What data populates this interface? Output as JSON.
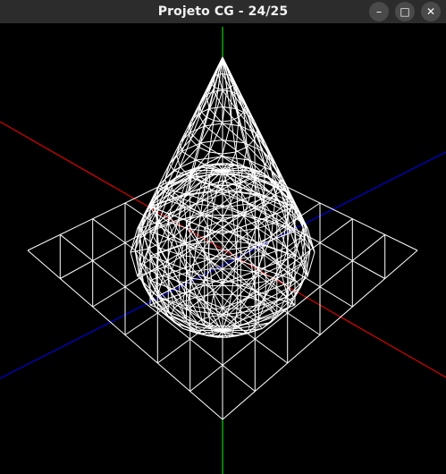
{
  "window": {
    "title": "Projeto CG - 24/25",
    "controls": {
      "minimize": {
        "icon": "minimize-icon",
        "glyph": "–"
      },
      "maximize": {
        "icon": "maximize-icon",
        "glyph": "□"
      },
      "close": {
        "icon": "close-icon",
        "glyph": "✕"
      }
    }
  },
  "scene": {
    "background": "#000000",
    "wireframe_color": "#ffffff",
    "axes": [
      {
        "name": "x-axis",
        "color": "#ff0000"
      },
      {
        "name": "y-axis",
        "color": "#00ff00"
      },
      {
        "name": "z-axis",
        "color": "#0000ff"
      }
    ],
    "objects": [
      "plane",
      "cone",
      "box",
      "sphere"
    ]
  }
}
